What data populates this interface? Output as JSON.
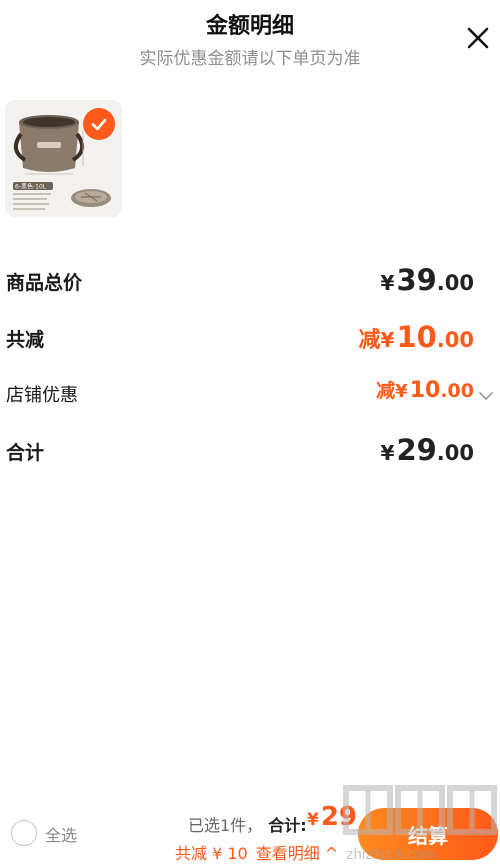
{
  "header": {
    "title": "金额明细",
    "subtitle": "实际优惠金额请以下单页为准"
  },
  "icons": {
    "close": "close-icon",
    "check": "check-icon",
    "chevron": "chevron-down-icon",
    "chevron_up": "chevron-up-icon"
  },
  "product": {
    "selected": true,
    "image_label": "6-黑色-10L"
  },
  "summary": {
    "goods_total": {
      "label": "商品总价",
      "yen": "¥",
      "int": "39",
      "dec": ".00"
    },
    "total_discount": {
      "label": "共减",
      "prefix": "减",
      "yen": "¥",
      "int": "10",
      "dec": ".00"
    },
    "shop_discount": {
      "label": "店铺优惠",
      "prefix": "减",
      "yen": "¥",
      "int": "10",
      "dec": ".00"
    },
    "grand_total": {
      "label": "合计",
      "yen": "¥",
      "int": "29",
      "dec": ".00"
    }
  },
  "footer": {
    "select_all": "全选",
    "selected_count": "已选1件，",
    "sum_label": "合计:",
    "total_yen": "¥",
    "total_int": "29",
    "discount_text": "共减 ¥ 10",
    "detail_link": "查看明细 ^",
    "checkout_label": "结算"
  },
  "watermark": {
    "text": "zhizhizhi.com"
  },
  "colors": {
    "accent": "#ff5a19",
    "text": "#1a1a1a",
    "muted": "#8e8e8e"
  }
}
